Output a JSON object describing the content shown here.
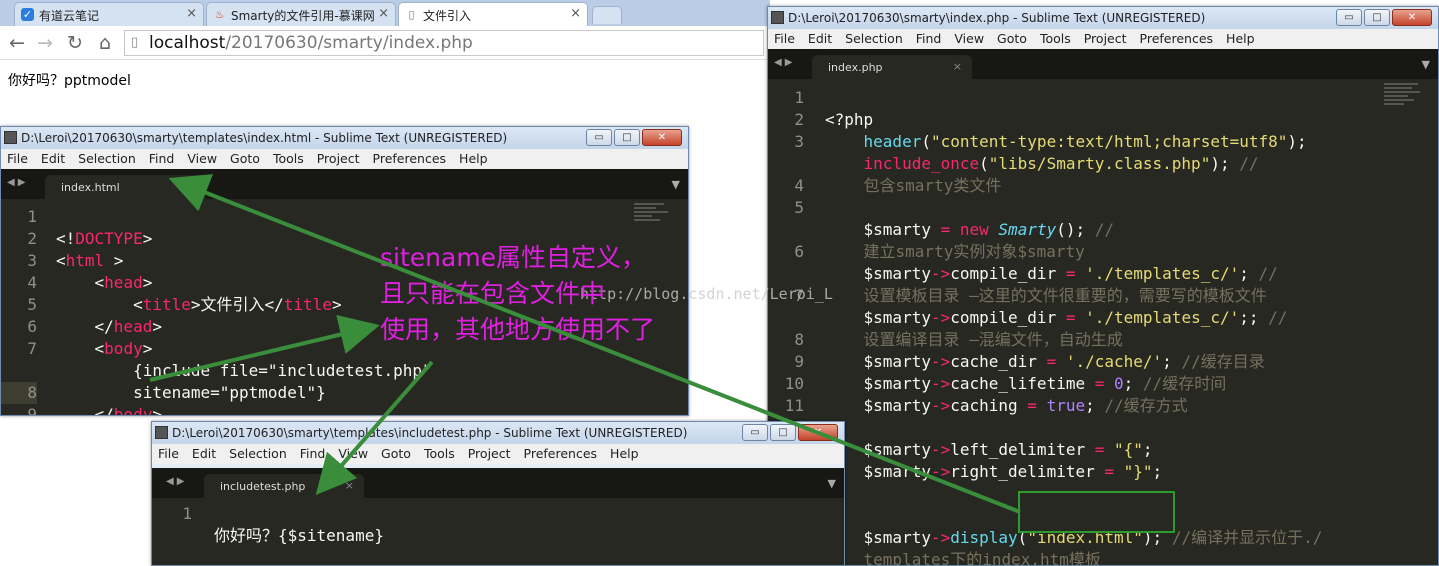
{
  "browser": {
    "tabs": [
      {
        "label": "有道云笔记",
        "icon": "youdao-icon",
        "active": false
      },
      {
        "label": "Smarty的文件引用-慕课网",
        "icon": "flame-icon",
        "active": false
      },
      {
        "label": "文件引入",
        "icon": "page-icon",
        "active": true
      }
    ],
    "url_host": "localhost",
    "url_path": "/20170630/smarty/index.php",
    "page_text": "你好吗？pptmodel"
  },
  "menu": [
    "File",
    "Edit",
    "Selection",
    "Find",
    "View",
    "Goto",
    "Tools",
    "Project",
    "Preferences",
    "Help"
  ],
  "win_index_html": {
    "title": "D:\\Leroi\\20170630\\smarty\\templates\\index.html - Sublime Text (UNREGISTERED)",
    "tab": "index.html",
    "line_numbers": [
      "1",
      "2",
      "3",
      "4",
      "5",
      "6",
      "7",
      "",
      "8",
      "9"
    ]
  },
  "win_index_php": {
    "title": "D:\\Leroi\\20170630\\smarty\\index.php - Sublime Text (UNREGISTERED)",
    "tab": "index.php",
    "line_numbers": [
      "1",
      "2",
      "3",
      "",
      "4",
      "5",
      "",
      "6",
      "",
      "7",
      "",
      "8",
      "9",
      "10",
      "11",
      "",
      "",
      "",
      "",
      ""
    ]
  },
  "win_include": {
    "title": "D:\\Leroi\\20170630\\smarty\\templates\\includetest.php - Sublime Text (UNREGISTERED)",
    "tab": "includetest.php",
    "line_numbers": [
      "1"
    ]
  },
  "annotation": {
    "line1": "sitename属性自定义，",
    "line2": "且只能在包含文件中",
    "line3": "使用，其他地方使用不了"
  },
  "watermark": "http://blog.csdn.net/Leroi_L",
  "window_buttons": {
    "min": "▭",
    "max": "□",
    "close": "✕"
  },
  "colors": {
    "annotation": "#e020e0",
    "arrow": "#3a8d3a",
    "editor_bg": "#272822"
  }
}
